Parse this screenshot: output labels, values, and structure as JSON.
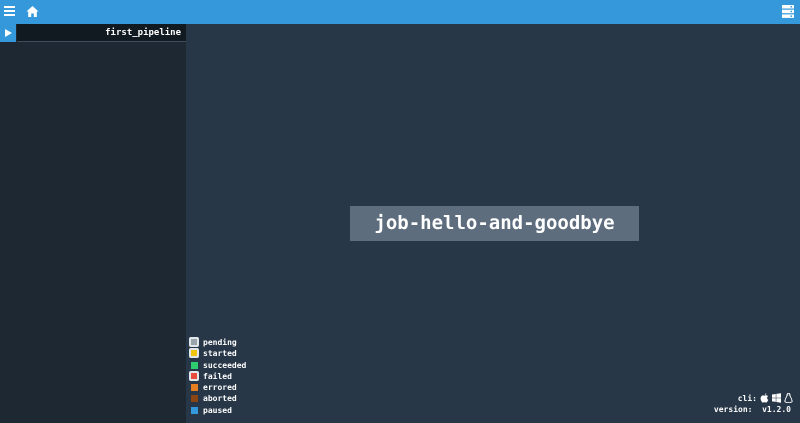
{
  "topbar": {
    "menu_icon": "hamburger-icon",
    "home_icon": "home-icon",
    "right_icon": "server-icon",
    "color": "#3498db"
  },
  "sidebar": {
    "pipelines": [
      {
        "name": "first_pipeline",
        "toggle_icon": "play-icon"
      }
    ]
  },
  "main": {
    "job_name": "job-hello-and-goodbye"
  },
  "legend": [
    {
      "label": "pending",
      "color": "#9aa4ad",
      "style": "boxed"
    },
    {
      "label": "started",
      "color": "#f1c40f",
      "style": "boxed"
    },
    {
      "label": "succeeded",
      "color": "#2ecc71",
      "style": "plain"
    },
    {
      "label": "failed",
      "color": "#e74c3c",
      "style": "boxed"
    },
    {
      "label": "errored",
      "color": "#e67e22",
      "style": "plain"
    },
    {
      "label": "aborted",
      "color": "#8b4513",
      "style": "plain"
    },
    {
      "label": "paused",
      "color": "#3498db",
      "style": "plain"
    }
  ],
  "footer": {
    "cli_label": "cli:",
    "cli_icons": [
      "apple-icon",
      "windows-icon",
      "linux-icon"
    ],
    "version_label": "version:",
    "version_value": "v1.2.0"
  }
}
